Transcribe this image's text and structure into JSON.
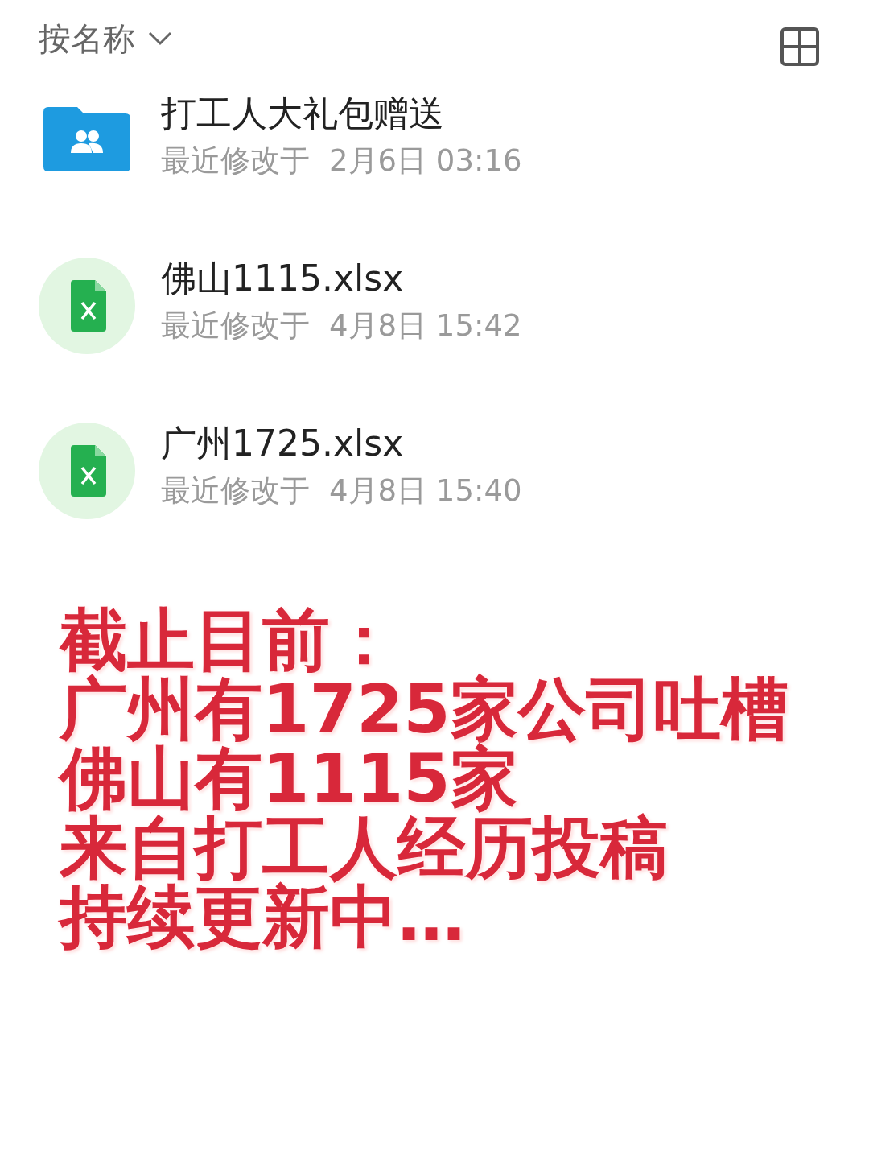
{
  "sort": {
    "label": "按名称"
  },
  "files": [
    {
      "kind": "folder",
      "name": "打工人大礼包赠送",
      "modified_label": "最近修改于",
      "modified": "2月6日 03:16"
    },
    {
      "kind": "spreadsheet",
      "name": "佛山1115.xlsx",
      "modified_label": "最近修改于",
      "modified": "4月8日 15:42"
    },
    {
      "kind": "spreadsheet",
      "name": "广州1725.xlsx",
      "modified_label": "最近修改于",
      "modified": "4月8日 15:40"
    }
  ],
  "overlay_text": [
    "截止目前：",
    "广州有1725家公司吐槽",
    "佛山有1115家",
    "来自打工人经历投稿",
    "持续更新中…"
  ]
}
